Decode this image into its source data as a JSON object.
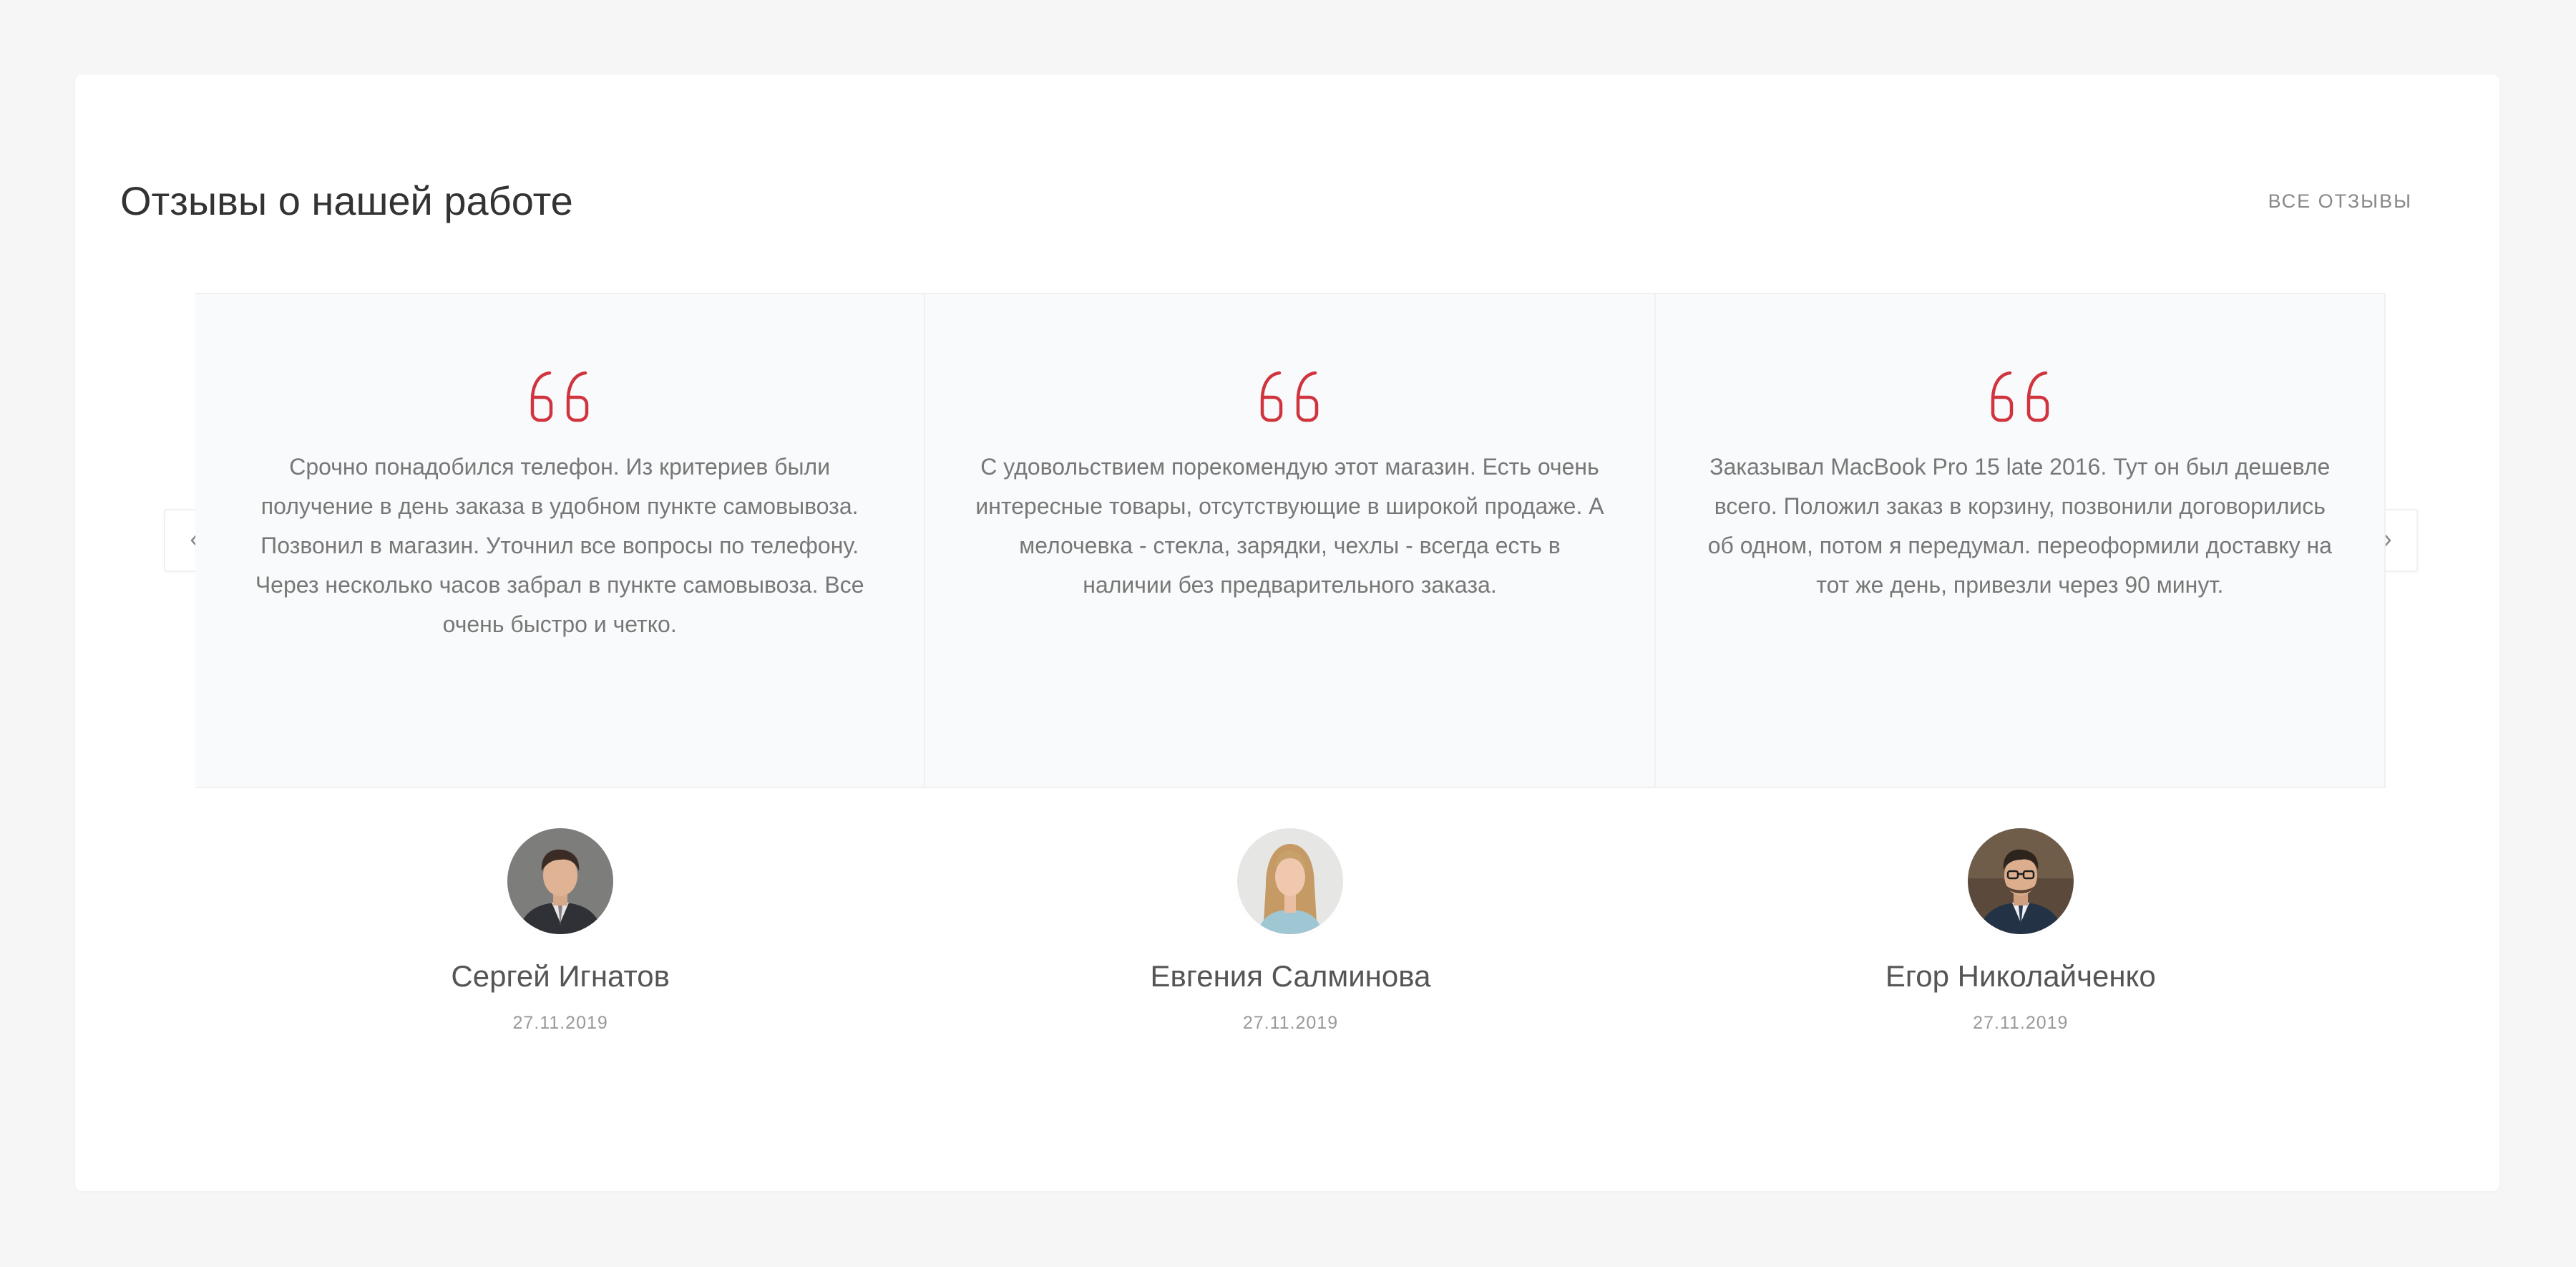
{
  "section": {
    "title": "Отзывы о нашей работе",
    "all_reviews_label": "ВСЕ ОТЗЫВЫ"
  },
  "colors": {
    "accent": "#d0343f",
    "card_background": "#f9fafb",
    "page_background": "#f6f6f6"
  },
  "slider": {
    "prev_icon": "chevron-left-icon",
    "next_icon": "chevron-right-icon"
  },
  "reviews": [
    {
      "text": "Срочно понадобился телефон. Из критериев были получение в день заказа в удобном пункте самовывоза. Позвонил в магазин. Уточнил все вопросы по телефону. Через несколько часов забрал в пункте самовывоза. Все очень быстро и четко.",
      "author": "Сергей Игнатов",
      "date": "27.11.2019",
      "icon": "quote-icon"
    },
    {
      "text": "С удовольствием порекомендую этот магазин. Есть очень интересные товары, отсутствующие в широкой продаже. А мелочевка - стекла, зарядки, чехлы - всегда есть в наличии без предварительного заказа.",
      "author": "Евгения Салминова",
      "date": "27.11.2019",
      "icon": "quote-icon"
    },
    {
      "text": "Заказывал MacBook Pro 15 late 2016. Тут он был дешевле всего. Положил заказ в корзину, позвонили договорились об одном, потом я передумал. переоформили доставку на тот же день, привезли через 90 минут.",
      "author": "Егор Николайченко",
      "date": "27.11.2019",
      "icon": "quote-icon"
    }
  ]
}
